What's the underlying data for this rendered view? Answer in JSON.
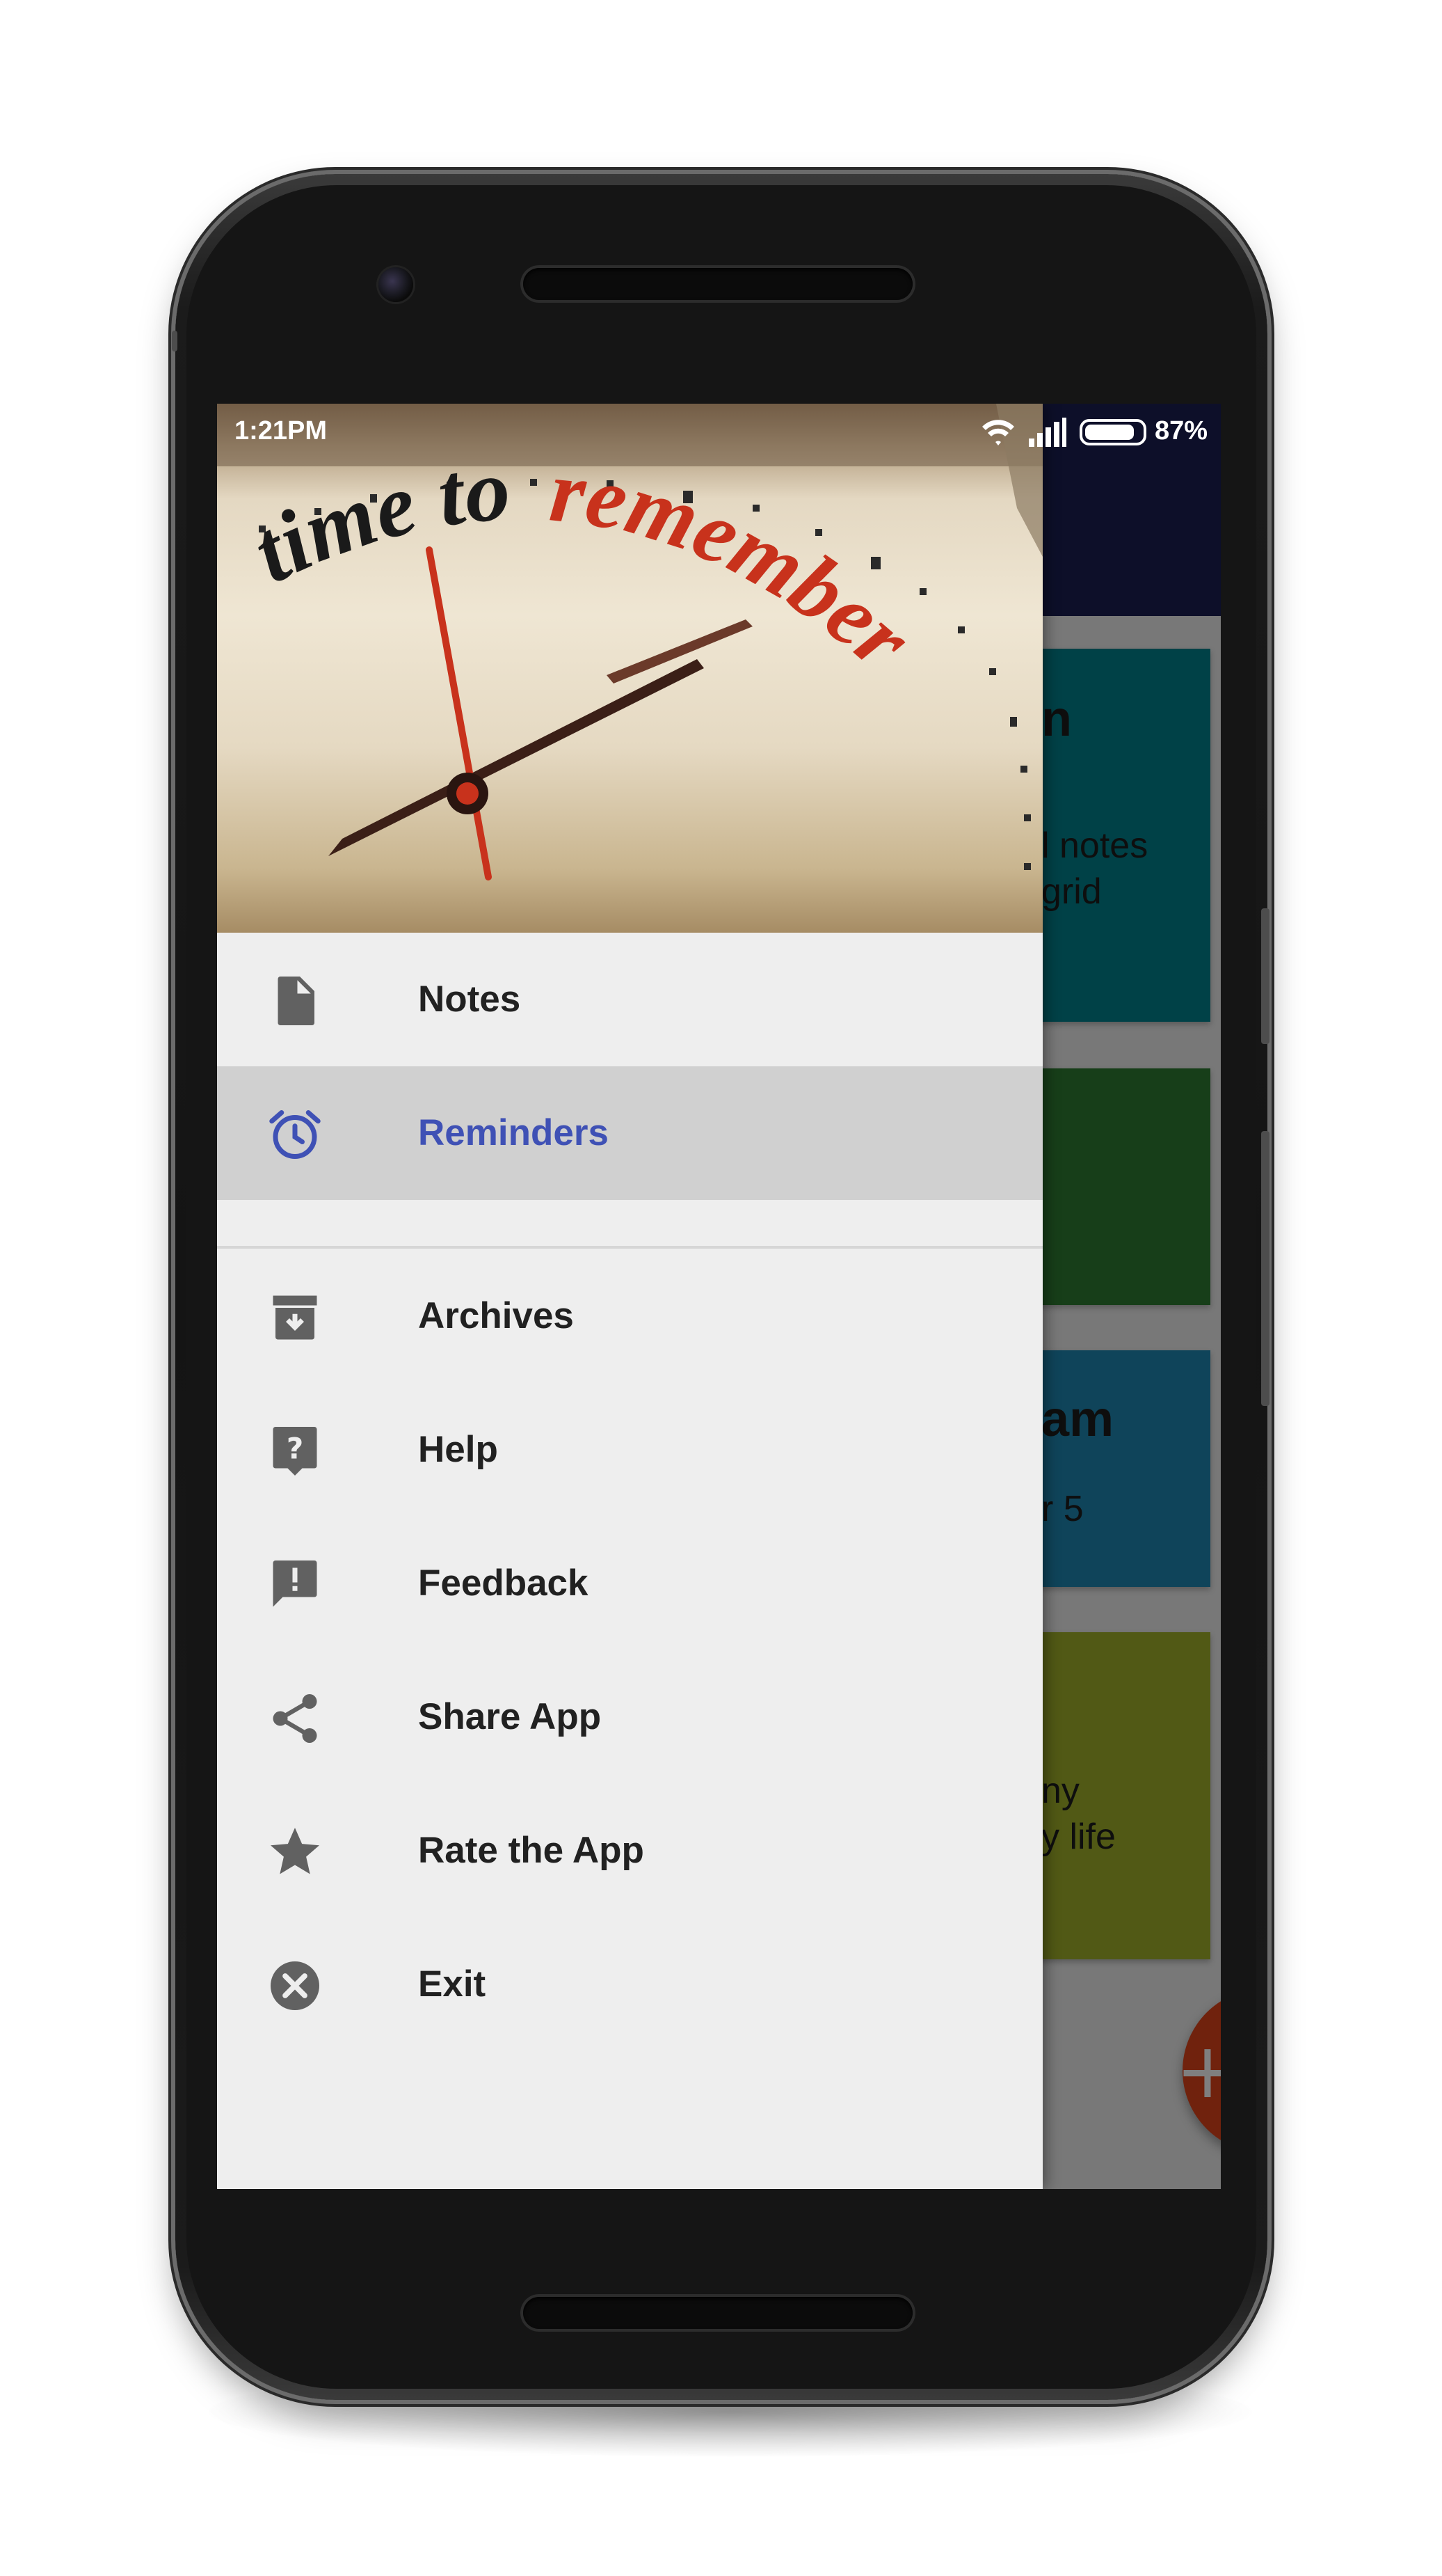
{
  "status_bar": {
    "time": "1:21PM",
    "battery_percent": "87%",
    "battery_level": 0.87
  },
  "drawer": {
    "header_image": {
      "text_part1": "time to",
      "text_part2": "remember"
    },
    "items": [
      {
        "label": "Notes",
        "icon": "file-icon"
      },
      {
        "label": "Reminders",
        "icon": "alarm-clock-icon",
        "selected": true
      },
      {
        "label": "Archives",
        "icon": "archive-icon"
      },
      {
        "label": "Help",
        "icon": "help-icon"
      },
      {
        "label": "Feedback",
        "icon": "feedback-icon"
      },
      {
        "label": "Share App",
        "icon": "share-icon"
      },
      {
        "label": "Rate the App",
        "icon": "star-icon"
      },
      {
        "label": "Exit",
        "icon": "close-circle-icon"
      }
    ]
  },
  "background_notes": [
    {
      "title": "n",
      "body": "l notes\ngrid",
      "color": "#00838f"
    },
    {
      "title": "",
      "body": "",
      "color": "#2e7d32"
    },
    {
      "title": "am",
      "body": "r 5",
      "color": "#1e88b5"
    },
    {
      "title": "",
      "body": "ny\ny life",
      "color": "#a2b32a"
    }
  ],
  "fab": {
    "symbol": "+"
  },
  "colors": {
    "toolbar": "#1a1f52",
    "accent": "#3f51b5",
    "fab": "#e0451a",
    "drawer_bg": "#eeeeee",
    "selected_bg": "#d0d0d0",
    "icon": "#616161"
  }
}
